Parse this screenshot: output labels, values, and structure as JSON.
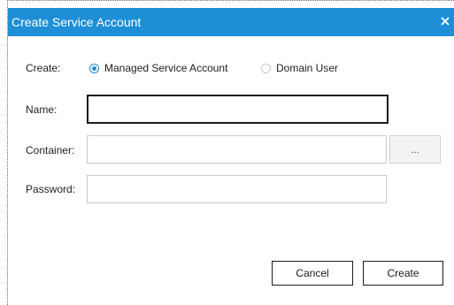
{
  "dialog": {
    "title": "Create Service Account",
    "close_icon": "close-icon",
    "accent_color": "#1e8fd6"
  },
  "form": {
    "create_label": "Create:",
    "options": [
      {
        "label": "Managed Service Account",
        "selected": true
      },
      {
        "label": "Domain User",
        "selected": false
      }
    ],
    "name_label": "Name:",
    "name_value": "",
    "container_label": "Container:",
    "container_value": "",
    "browse_label": "...",
    "password_label": "Password:",
    "password_value": ""
  },
  "buttons": {
    "cancel": "Cancel",
    "create": "Create"
  }
}
